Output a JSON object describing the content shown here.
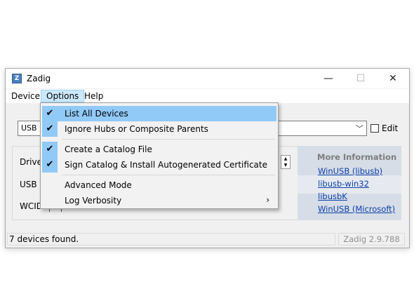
{
  "window": {
    "title": "Zadig",
    "app_icon": "zadig-icon",
    "app_icon_glyph": "Z",
    "controls": {
      "minimize": "—",
      "maximize": "☐",
      "close": "✕"
    }
  },
  "menu": [
    "Device",
    "Options",
    "Help"
  ],
  "device_combo": {
    "value": "USB R",
    "edit_label": "Edit"
  },
  "labels": {
    "driver": "Driver",
    "usb_id": "USB ID",
    "wcid": "WCID"
  },
  "dropdown": {
    "items": [
      {
        "label": "List All Devices",
        "checked": true
      },
      {
        "label": "Ignore Hubs or Composite Parents",
        "checked": true
      },
      {
        "label": "Create a Catalog File",
        "checked": true
      },
      {
        "label": "Sign Catalog & Install Autogenerated Certificate",
        "checked": true
      },
      {
        "label": "Advanced Mode",
        "checked": false
      },
      {
        "label": "Log Verbosity",
        "checked": false,
        "submenu": "›"
      }
    ]
  },
  "info": {
    "title": "More Information",
    "links": [
      "WinUSB (libusb)",
      "libusb-win32",
      "libusbK",
      "WinUSB (Microsoft)"
    ]
  },
  "status": {
    "text": "7 devices found.",
    "version": "Zadig 2.9.788"
  },
  "colors": {
    "highlight": "#91c9f7",
    "link": "#0b3ea8",
    "menu_active": "#cce8ff"
  }
}
